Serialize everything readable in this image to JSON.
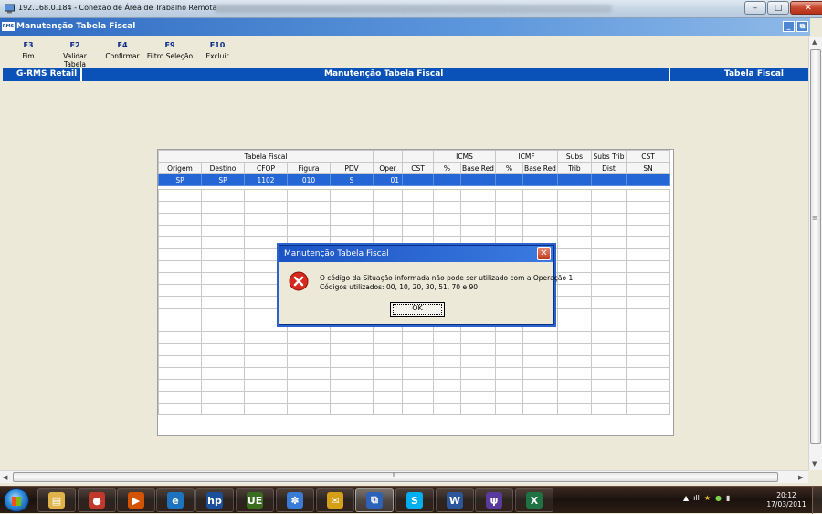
{
  "rdp_window": {
    "title": "192.168.0.184 - Conexão de Área de Trabalho Remota",
    "minimize": "–",
    "maximize": "□",
    "close": "✕"
  },
  "app": {
    "logo": "RMS",
    "title": "Manutenção Tabela Fiscal",
    "minimize": "_",
    "restore": "⧉"
  },
  "toolbar": {
    "items": [
      {
        "key": "F3",
        "label": "Fim"
      },
      {
        "key": "F2",
        "label": "Validar Tabela"
      },
      {
        "key": "F4",
        "label": "Confirmar"
      },
      {
        "key": "F9",
        "label": "Filtro Seleção"
      },
      {
        "key": "F10",
        "label": "Excluir"
      }
    ]
  },
  "header_bar": {
    "left": "G-RMS Retail",
    "center": "Manutenção Tabela Fiscal",
    "right": "Tabela Fiscal"
  },
  "grid": {
    "group_headers": {
      "tabela_fiscal": "Tabela Fiscal",
      "icms": "ICMS",
      "icmf": "ICMF",
      "subs": "Subs",
      "subs_trib": "Subs Trib",
      "cst": "CST"
    },
    "columns": [
      "Origem",
      "Destino",
      "CFOP",
      "Figura",
      "PDV",
      "Oper",
      "CST",
      "%",
      "Base Red",
      "%",
      "Base Red",
      "Trib",
      "Dist",
      "SN"
    ],
    "rows": [
      [
        "SP",
        "SP",
        "1102",
        "010",
        "S",
        "01",
        "",
        "",
        "",
        "",
        "",
        "",
        "",
        ""
      ]
    ]
  },
  "dialog": {
    "title": "Manutenção Tabela Fiscal",
    "close": "✕",
    "message_line1": "O código da Situação informada não pode ser utilizado com a Operação 1.",
    "message_line2": "Códigos utilizados: 00, 10, 20, 30, 51, 70 e 90",
    "ok_label": "OK"
  },
  "taskbar": {
    "apps": [
      {
        "name": "explorer",
        "glyph": "▤",
        "color": "#e0b24a"
      },
      {
        "name": "media-player",
        "glyph": "●",
        "color": "#c0392b"
      },
      {
        "name": "media-center",
        "glyph": "▶",
        "color": "#d35400"
      },
      {
        "name": "internet-explorer",
        "glyph": "e",
        "color": "#1e73be"
      },
      {
        "name": "hp",
        "glyph": "hp",
        "color": "#1a4f9c"
      },
      {
        "name": "ultraedit",
        "glyph": "UE",
        "color": "#3a6e1e"
      },
      {
        "name": "people",
        "glyph": "✽",
        "color": "#3a7bd5"
      },
      {
        "name": "outlook",
        "glyph": "✉",
        "color": "#d4a017"
      },
      {
        "name": "remote-desktop",
        "glyph": "⧉",
        "color": "#2c62b8"
      },
      {
        "name": "skype",
        "glyph": "S",
        "color": "#00aff0"
      },
      {
        "name": "word",
        "glyph": "W",
        "color": "#2b579a"
      },
      {
        "name": "vs",
        "glyph": "ψ",
        "color": "#5a3a9c"
      },
      {
        "name": "excel",
        "glyph": "X",
        "color": "#1f7244"
      }
    ],
    "tray": {
      "up_arrow": "▲",
      "signal": "ıll",
      "star": "★",
      "shield": "●",
      "battery": "▮"
    },
    "clock_time": "20:12",
    "clock_date": "17/03/2011"
  }
}
